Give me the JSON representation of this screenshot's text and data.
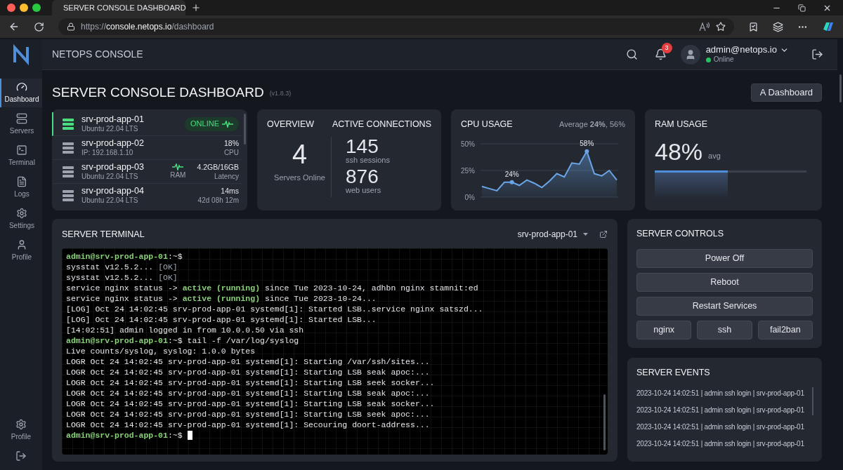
{
  "browser": {
    "tab_title": "SERVER CONSOLE DASHBOARD",
    "url": {
      "scheme": "https://",
      "host": "console.netops.io",
      "path": "/dashboard"
    }
  },
  "sidebar": {
    "items": [
      {
        "label": "Dashboard",
        "kind": "gauge",
        "selected": true
      },
      {
        "label": "Servers",
        "kind": "servers",
        "selected": false
      },
      {
        "label": "Terminal",
        "kind": "terminal",
        "selected": false
      },
      {
        "label": "Logs",
        "kind": "logs",
        "selected": false
      },
      {
        "label": "Settings",
        "kind": "settings",
        "selected": false
      },
      {
        "label": "Profile",
        "kind": "user",
        "selected": false
      }
    ],
    "bottom": {
      "label": "Profile"
    }
  },
  "header": {
    "brand": "NETOPS CONSOLE",
    "notifications": "3",
    "user": "admin@netops.io",
    "status": "Online",
    "online": true
  },
  "page": {
    "title": "SERVER CONSOLE DASHBOARD",
    "version": "(v1.8.3)",
    "button": "A Dashboard"
  },
  "servers": [
    {
      "name": "srv-prod-app-01",
      "detail": "Ubuntu 22.04 LTS",
      "badge": "ONLINE",
      "selected": true
    },
    {
      "name": "srv-prod-app-02",
      "detail": "IP: 192.168.1.10",
      "metric": "18%",
      "metric_label": "CPU",
      "selected": false
    },
    {
      "name": "srv-prod-app-03",
      "detail": "Ubuntu 22.04 LTS",
      "mid_label": "RAM",
      "metric": "4.2GB/16GB",
      "metric_label": "Latency",
      "selected": false
    },
    {
      "name": "srv-prod-app-04",
      "detail": "Ubuntu 22.04 LTS",
      "metric": "14ms",
      "metric_label": "42d 08h 12m",
      "selected": false
    }
  ],
  "overview": {
    "title": "OVERVIEW",
    "count": "4",
    "count_label": "Servers Online",
    "connections_title": "ACTIVE CONNECTIONS",
    "connections": [
      {
        "value": "145",
        "label": "ssh sessions"
      },
      {
        "value": "876",
        "label": "web users"
      }
    ]
  },
  "cpu": {
    "title": "CPU USAGE",
    "summary": "Average **24%**, 56%",
    "callouts": [
      "24%",
      "58%"
    ],
    "chart_data": {
      "type": "area",
      "series": [
        {
          "color": "#6aa5e8",
          "values": [
            10,
            8,
            6,
            14,
            14,
            11,
            16,
            13,
            9,
            15,
            22,
            19,
            32,
            31,
            43,
            22,
            20,
            25,
            16
          ]
        }
      ],
      "ylim": [
        0,
        50
      ],
      "yticks": [
        {
          "value": 0,
          "label": "0%"
        },
        {
          "value": 25,
          "label": "25%"
        },
        {
          "value": 50,
          "label": "50%"
        }
      ]
    }
  },
  "ram": {
    "title": "RAM USAGE",
    "value": "48%",
    "unit": "avg",
    "level": 0.48
  },
  "terminal": {
    "title": "SERVER TERMINAL",
    "server": "srv-prod-app-01",
    "cursor": true,
    "lines": [
      [
        {
          "kind": "prompt",
          "text": "admin@srv-prod-app-01"
        },
        {
          "kind": "plain",
          "text": ":~$"
        }
      ],
      [
        {
          "kind": "plain",
          "text": "sysstat v12.5.2... "
        },
        {
          "kind": "ok",
          "text": "[OK]"
        }
      ],
      [
        {
          "kind": "plain",
          "text": "sysstat v12.5.2... "
        },
        {
          "kind": "ok",
          "text": "[OK]"
        }
      ],
      [
        {
          "kind": "plain",
          "text": "service nginx status -> "
        },
        {
          "kind": "active",
          "text": "active (running)"
        },
        {
          "kind": "plain",
          "text": " since Tue 2023-10-24, adhbn nginx stamnit:ed"
        }
      ],
      [
        {
          "kind": "plain",
          "text": "service nginx status -> "
        },
        {
          "kind": "active",
          "text": "active (running)"
        },
        {
          "kind": "plain",
          "text": " since Tue 2023-10-24..."
        }
      ],
      [
        {
          "kind": "plain",
          "text": "[LOG] Oct 24 14:02:45 srv-prod-app-01 systemd[1]: Started LSB..service nginx satszd..."
        }
      ],
      [
        {
          "kind": "plain",
          "text": "[LOG] Oct 24 14:02:45 srv-prod-app-01 systemd[1]: Started LSB..."
        }
      ],
      [
        {
          "kind": "plain",
          "text": "[14:02:51] admin logged in from 10.0.0.50 via ssh"
        }
      ],
      [
        {
          "kind": "prompt",
          "text": "admin@srv-prod-app-01"
        },
        {
          "kind": "plain",
          "text": ":~$ tail -f /var/log/syslog"
        }
      ],
      [
        {
          "kind": "plain",
          "text": "Live counts/syslog, syslog: 1.0.0 bytes"
        }
      ],
      [
        {
          "kind": "plain",
          "text": "LOGR Oct 24 14:02:45 srv-prod-app-01 systemd[1]: Starting /var/ssh/sites..."
        }
      ],
      [
        {
          "kind": "plain",
          "text": "LOGR Oct 24 14:02:45 srv-prod-app-01 systemd[1]: Starting LSB seak apoc:..."
        }
      ],
      [
        {
          "kind": "plain",
          "text": "LOGR Oct 24 14:02:45 srv-prod-app-01 systemd[1]: Starting LSB seek socker..."
        }
      ],
      [
        {
          "kind": "plain",
          "text": "LOGR Oct 24 14:02:45 srv-prod-app-01 systemd[1]: Starting LSB seak apoc:..."
        }
      ],
      [
        {
          "kind": "plain",
          "text": "LOGR Oct 24 14:02:45 srv-prod-app-01 systemd[1]: Starting LSB seak socker..."
        }
      ],
      [
        {
          "kind": "plain",
          "text": "LOGR Oct 24 14:02:45 srv-prod-app-01 systemd[1]: Starting LSB seek apoc:..."
        }
      ],
      [
        {
          "kind": "plain",
          "text": "LOGR Oct 24 14:02:45 srv-prod-app-01 systemd[1]: Secouring doort-address..."
        }
      ],
      [
        {
          "kind": "prompt",
          "text": "admin@srv-prod-app-01"
        },
        {
          "kind": "plain",
          "text": ":~$"
        }
      ]
    ]
  },
  "controls": {
    "title": "SERVER CONTROLS",
    "buttons": [
      "Power Off",
      "Reboot",
      "Restart Services"
    ],
    "services": [
      "nginx",
      "ssh",
      "fail2ban"
    ]
  },
  "events": {
    "title": "SERVER EVENTS",
    "items": [
      "2023-10-24 14:02:51 | admin ssh login | srv-prod-app-01",
      "2023-10-24 14:02:51 | admin ssh login | srv-prod-app-01",
      "2023-10-24 14:02:51 | admin ssh login | srv-prod-app-01",
      "2023-10-24 14:02:51 | admin ssh login | srv-prod-app-01"
    ]
  }
}
